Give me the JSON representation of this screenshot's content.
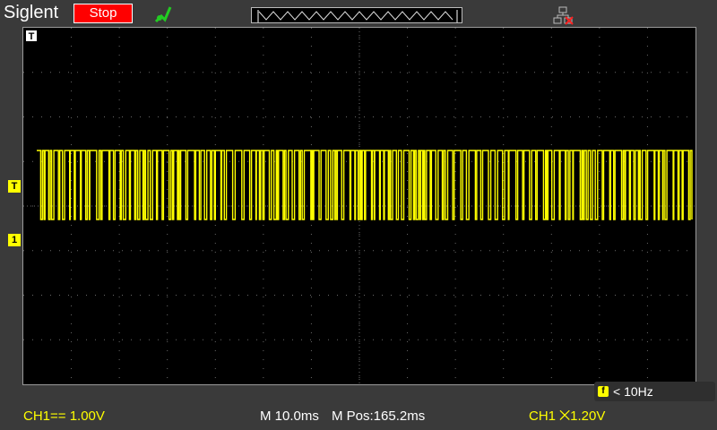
{
  "header": {
    "brand": "Siglent",
    "run_state_label": "Stop",
    "probe_icon": "probe-icon",
    "network_icon": "network-disconnected-icon"
  },
  "screen": {
    "trigger_position_marker": "T",
    "trigger_level_marker": "T",
    "ch1_ground_marker": "1",
    "frequency_icon_letter": "f",
    "frequency_readout": "< 10Hz"
  },
  "status_bar": {
    "ch1_scale": "CH1== 1.00V",
    "timebase": "M 10.0ms",
    "m_pos": "M Pos:165.2ms",
    "trigger": "CH1 ⨉1.20V"
  },
  "colors": {
    "trace": "#ffff00",
    "stop": "#ff0000",
    "grid": "#6a6a6a"
  }
}
